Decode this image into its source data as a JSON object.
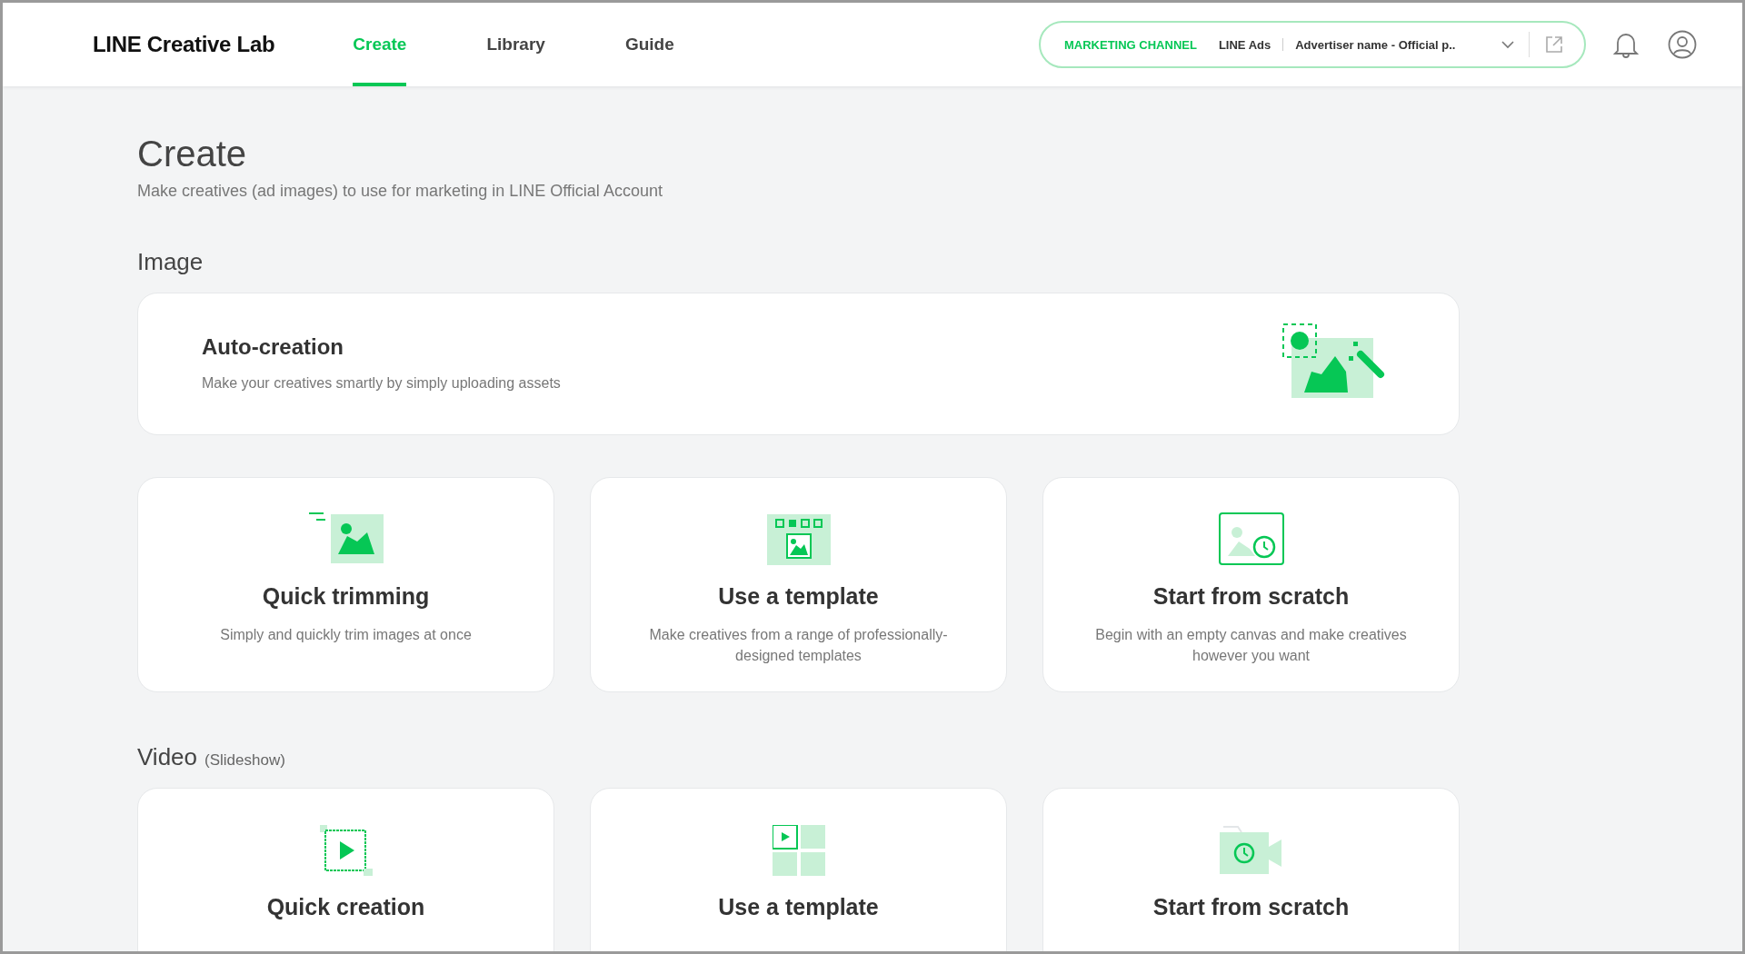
{
  "header": {
    "logo": "LINE Creative Lab",
    "nav": [
      {
        "label": "Create",
        "selected": true
      },
      {
        "label": "Library",
        "selected": false
      },
      {
        "label": "Guide",
        "selected": false
      }
    ],
    "channel": {
      "label": "MARKETING CHANNEL",
      "service": "LINE Ads",
      "account": "Advertiser name - Official p.."
    }
  },
  "page": {
    "title": "Create",
    "subtitle": "Make creatives (ad images) to use for marketing in LINE Official Account"
  },
  "sections": [
    {
      "title": "Image",
      "wide_card": {
        "title": "Auto-creation",
        "description": "Make your creatives smartly by simply uploading assets",
        "kind": "auto"
      },
      "cards": [
        {
          "title": "Quick trimming",
          "description": "Simply and quickly trim images at once",
          "kind": "trim"
        },
        {
          "title": "Use a template",
          "description": "Make creatives from a range of professionally-designed templates",
          "kind": "template"
        },
        {
          "title": "Start from scratch",
          "description": "Begin with an empty canvas and make creatives however you want",
          "kind": "scratch"
        }
      ]
    },
    {
      "title": "Video",
      "note": "(Slideshow)",
      "cards": [
        {
          "title": "Quick creation",
          "kind": "video-quick"
        },
        {
          "title": "Use a template",
          "kind": "video-template"
        },
        {
          "title": "Start from scratch",
          "kind": "video-scratch"
        }
      ]
    }
  ]
}
